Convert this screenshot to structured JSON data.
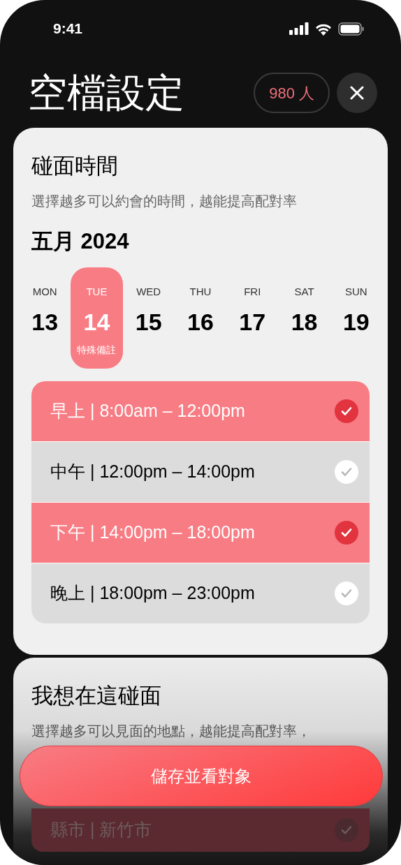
{
  "status_bar": {
    "time": "9:41"
  },
  "header": {
    "title": "空檔設定",
    "count_badge": "980 人"
  },
  "time_card": {
    "title": "碰面時間",
    "subtitle": "選擇越多可以約會的時間，越能提高配對率",
    "month": "五月 2024",
    "days": [
      {
        "weekday": "MON",
        "date": "13",
        "selected": false
      },
      {
        "weekday": "TUE",
        "date": "14",
        "selected": true,
        "note": "特殊備註"
      },
      {
        "weekday": "WED",
        "date": "15",
        "selected": false
      },
      {
        "weekday": "THU",
        "date": "16",
        "selected": false
      },
      {
        "weekday": "FRI",
        "date": "17",
        "selected": false
      },
      {
        "weekday": "SAT",
        "date": "18",
        "selected": false
      },
      {
        "weekday": "SUN",
        "date": "19",
        "selected": false
      }
    ],
    "slots": [
      {
        "label": "早上 | 8:00am – 12:00pm",
        "selected": true
      },
      {
        "label": "中午 | 12:00pm – 14:00pm",
        "selected": false
      },
      {
        "label": "下午 | 14:00pm – 18:00pm",
        "selected": true
      },
      {
        "label": "晚上 | 18:00pm – 23:00pm",
        "selected": false
      }
    ]
  },
  "place_card": {
    "title": "我想在這碰面",
    "subtitle": "選擇越多可以見面的地點，越能提高配對率，",
    "places": [
      {
        "label": "縣市 | 新竹市",
        "selected": true
      }
    ]
  },
  "save_button": "儲存並看對象"
}
